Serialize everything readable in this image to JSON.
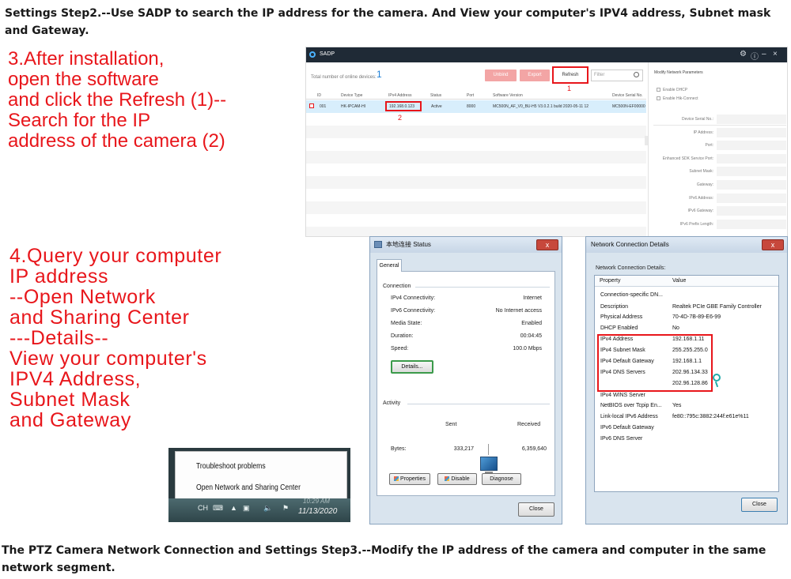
{
  "captions": {
    "top": "Settings Step2.--Use SADP to search the IP address for the camera. And View your computer's IPV4 address, Subnet mask and Gateway.",
    "bottom": "The PTZ Camera Network Connection and Settings Step3.--Modify the IP address of the camera and computer in the same network segment."
  },
  "note3": {
    "lines": [
      "3.After installation,",
      "open the software",
      "and click the Refresh (1)--",
      "Search for the IP",
      "address of the camera (2)"
    ]
  },
  "note4": {
    "lines": [
      "4.Query your computer",
      "IP address",
      "--Open Network",
      "and Sharing Center",
      "---Details--",
      "View your computer's",
      "IPV4 Address,",
      "Subnet Mask",
      "and Gateway"
    ]
  },
  "sadp": {
    "app_name": "SADP",
    "total_label": "Total number of online devices:",
    "total_count": "1",
    "buttons": {
      "unbind": "Unbind",
      "export": "Export",
      "refresh": "Refresh"
    },
    "filter_placeholder": "Filter",
    "marker_1": "1",
    "marker_2": "2",
    "columns": [
      "ID",
      "Device Type",
      "IPv4 Address",
      "Status",
      "Port",
      "Software Version",
      "Device Serial No."
    ],
    "row": {
      "id": "001",
      "device_type": "HK-IPCAM-HI",
      "ipv4": "192.168.0.123",
      "status": "Active",
      "port": "8000",
      "software_version": "MC500N_AF_V0_BU-H5 V3.0.2.1 build 2020-05-11 12",
      "serial": "MC500N-EF00000"
    },
    "side": {
      "title": "Modify Network Parameters",
      "enable_dhcp": "Enable DHCP",
      "enable_hik": "Enable Hik-Connect",
      "fields": [
        "Device Serial No.:",
        "IP Address:",
        "Port:",
        "Enhanced SDK Service Port:",
        "Subnet Mask:",
        "Gateway:",
        "IPv6 Address:",
        "IPv6 Gateway:",
        "IPv6 Prefix Length:"
      ]
    }
  },
  "status_dialog": {
    "title": "本地连接 Status",
    "close_x": "x",
    "tab": "General",
    "connection_label": "Connection",
    "rows": [
      {
        "label": "IPv4 Connectivity:",
        "value": "Internet"
      },
      {
        "label": "IPv6 Connectivity:",
        "value": "No Internet access"
      },
      {
        "label": "Media State:",
        "value": "Enabled"
      },
      {
        "label": "Duration:",
        "value": "00:04:45"
      },
      {
        "label": "Speed:",
        "value": "100.0 Mbps"
      }
    ],
    "details_button": "Details...",
    "activity_label": "Activity",
    "sent_label": "Sent",
    "received_label": "Received",
    "bytes_label": "Bytes:",
    "bytes_sent": "333,217",
    "bytes_received": "6,359,640",
    "properties_button": "Properties",
    "disable_button": "Disable",
    "diagnose_button": "Diagnose",
    "close_button": "Close"
  },
  "details_dialog": {
    "title": "Network Connection Details",
    "close_x": "x",
    "heading": "Network Connection Details:",
    "col_property": "Property",
    "col_value": "Value",
    "rows": [
      {
        "p": "Connection-specific DN...",
        "v": ""
      },
      {
        "p": "Description",
        "v": "Realtek PCIe GBE Family Controller"
      },
      {
        "p": "Physical Address",
        "v": "70-4D-7B-89-E6-99"
      },
      {
        "p": "DHCP Enabled",
        "v": "No"
      },
      {
        "p": "IPv4 Address",
        "v": "192.168.1.11"
      },
      {
        "p": "IPv4 Subnet Mask",
        "v": "255.255.255.0"
      },
      {
        "p": "IPv4 Default Gateway",
        "v": "192.168.1.1"
      },
      {
        "p": "IPv4 DNS Servers",
        "v": "202.96.134.33"
      },
      {
        "p": "",
        "v": "202.96.128.86"
      },
      {
        "p": "IPv4 WINS Server",
        "v": ""
      },
      {
        "p": "NetBIOS over Tcpip En...",
        "v": "Yes"
      },
      {
        "p": "Link-local IPv6 Address",
        "v": "fe80::795c:3882:244f:e61e%11"
      },
      {
        "p": "IPv6 Default Gateway",
        "v": ""
      },
      {
        "p": "IPv6 DNS Server",
        "v": ""
      }
    ],
    "close_button": "Close"
  },
  "taskbar": {
    "menu_items": [
      "Troubleshoot problems",
      "Open Network and Sharing Center"
    ],
    "tray_lang": "CH",
    "time": "10:29 AM",
    "date": "11/13/2020"
  }
}
